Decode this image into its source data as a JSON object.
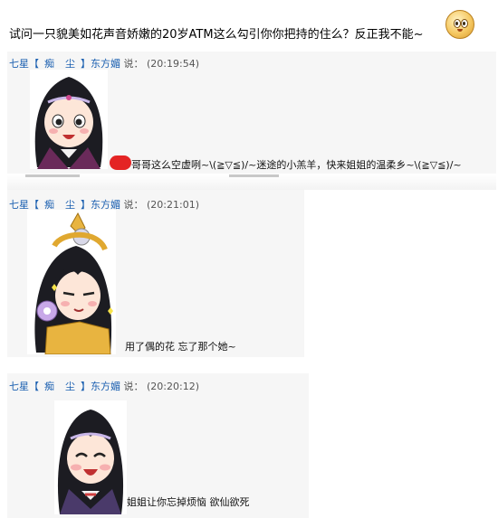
{
  "headline": "试问一只貌美如花声音娇嫩的20岁ATM这么勾引你你把持的住么？反正我不能~",
  "posts": [
    {
      "user_prefix": "七星【",
      "user_mid1": "痴",
      "user_mid2": "尘",
      "user_suffix": "】东方媚",
      "says": "说：",
      "time": "(20:19:54)",
      "message": "哥哥这么空虚咧~\\(≧▽≦)/~迷途的小羔羊，快来姐姐的温柔乡~\\(≧▽≦)/~"
    },
    {
      "user_prefix": "七星【",
      "user_mid1": "痴",
      "user_mid2": "尘",
      "user_suffix": "】东方媚",
      "says": "说：",
      "time": "(20:21:01)",
      "message": "用了偶的花  忘了那个她~"
    },
    {
      "user_prefix": "七星【",
      "user_mid1": "痴",
      "user_mid2": "尘",
      "user_suffix": "】东方媚",
      "says": "说：",
      "time": "(20:20:12)",
      "message": "姐姐让你忘掉烦恼  欲仙欲死"
    }
  ],
  "colors": {
    "username": "#1a5fb0",
    "panel": "#f6f6f6",
    "hair": "#1c1c22",
    "redact": "#e42424"
  }
}
